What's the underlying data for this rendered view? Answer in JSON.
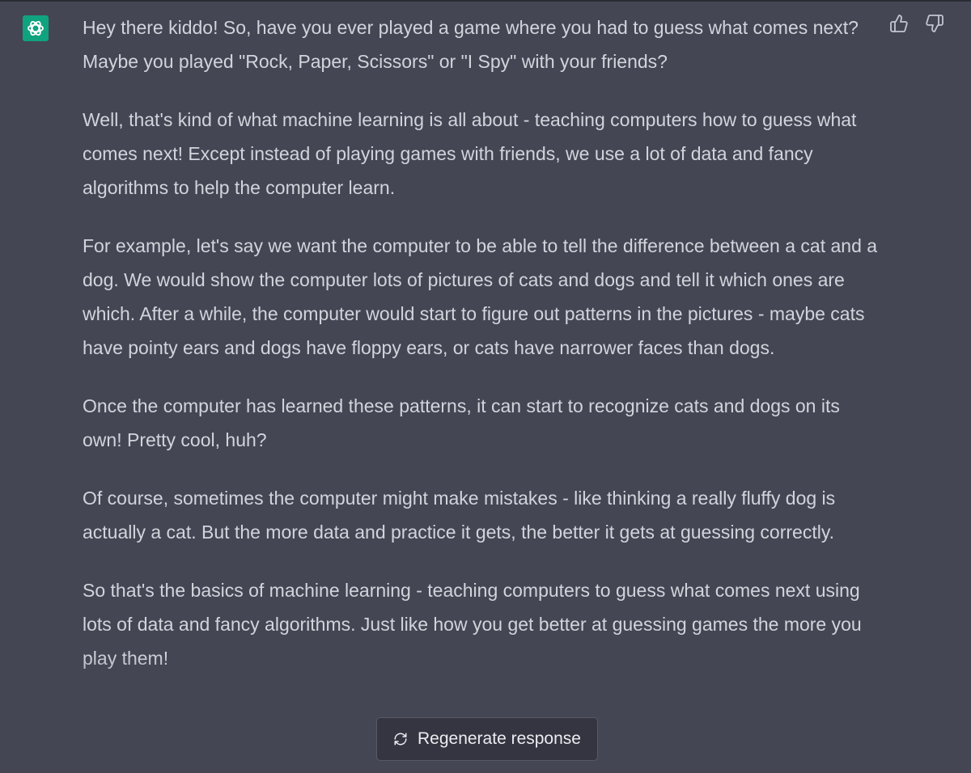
{
  "chat": {
    "assistant": {
      "avatar_icon": "openai-logo-icon",
      "avatar_color": "#10a37f",
      "paragraphs": [
        "Hey there kiddo! So, have you ever played a game where you had to guess what comes next? Maybe you played \"Rock, Paper, Scissors\" or \"I Spy\" with your friends?",
        "Well, that's kind of what machine learning is all about - teaching computers how to guess what comes next! Except instead of playing games with friends, we use a lot of data and fancy algorithms to help the computer learn.",
        "For example, let's say we want the computer to be able to tell the difference between a cat and a dog. We would show the computer lots of pictures of cats and dogs and tell it which ones are which. After a while, the computer would start to figure out patterns in the pictures - maybe cats have pointy ears and dogs have floppy ears, or cats have narrower faces than dogs.",
        "Once the computer has learned these patterns, it can start to recognize cats and dogs on its own! Pretty cool, huh?",
        "Of course, sometimes the computer might make mistakes - like thinking a really fluffy dog is actually a cat. But the more data and practice it gets, the better it gets at guessing correctly.",
        "So that's the basics of machine learning - teaching computers to guess what comes next using lots of data and fancy algorithms. Just like how you get better at guessing games the more you play them!"
      ]
    },
    "feedback": {
      "thumbs_up_icon": "thumbs-up-icon",
      "thumbs_down_icon": "thumbs-down-icon"
    }
  },
  "controls": {
    "regenerate_label": "Regenerate response",
    "regenerate_icon": "refresh-icon"
  },
  "colors": {
    "background": "#444654",
    "text": "#d1d5db",
    "button_background": "#343541",
    "button_border": "#575a67"
  }
}
